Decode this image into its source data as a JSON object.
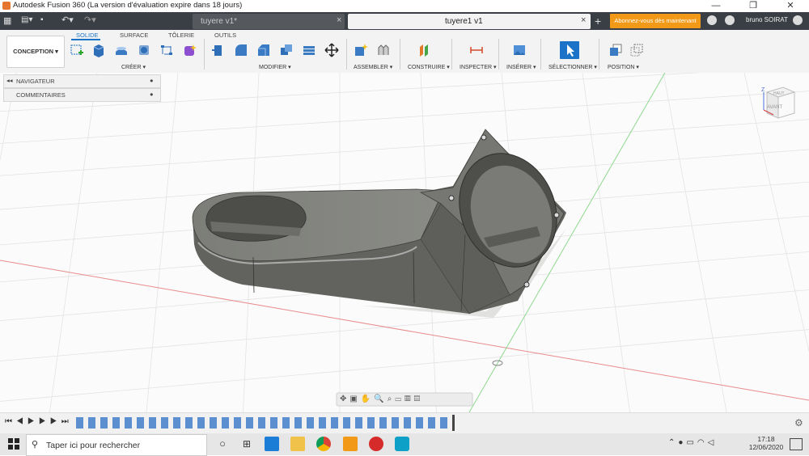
{
  "window": {
    "title": "Autodesk Fusion 360 (La version d'évaluation expire dans 18 jours)",
    "controls": [
      "—",
      "❐",
      "✕"
    ]
  },
  "tabs": [
    {
      "label": "tuyere v1*",
      "active": false
    },
    {
      "label": "tuyere1 v1",
      "active": true
    }
  ],
  "subscribe_button": "Abonnez-vous dès maintenant",
  "user": "bruno SOIRAT",
  "workspace": "CONCEPTION",
  "ribbon_tabs": [
    "SOLIDE",
    "SURFACE",
    "TÔLERIE",
    "OUTILS"
  ],
  "ribbon_groups": [
    "CRÉER ▾",
    "MODIFIER ▾",
    "ASSEMBLER ▾",
    "CONSTRUIRE ▾",
    "INSPECTER ▾",
    "INSÉRER ▾",
    "SÉLECTIONNER ▾",
    "POSITION ▾"
  ],
  "browser": {
    "navigator": "NAVIGATEUR",
    "comments": "COMMENTAIRES"
  },
  "viewcube": {
    "top": "HAUT",
    "front": "AVANT",
    "axis_z": "Z",
    "axis_x": "X"
  },
  "taskbar": {
    "search_placeholder": "Taper ici pour rechercher",
    "time": "17:18",
    "date": "12/06/2020"
  },
  "colors": {
    "accent": "#f29a17",
    "tab_strip": "#3a3f45",
    "model": "#6f706b"
  }
}
